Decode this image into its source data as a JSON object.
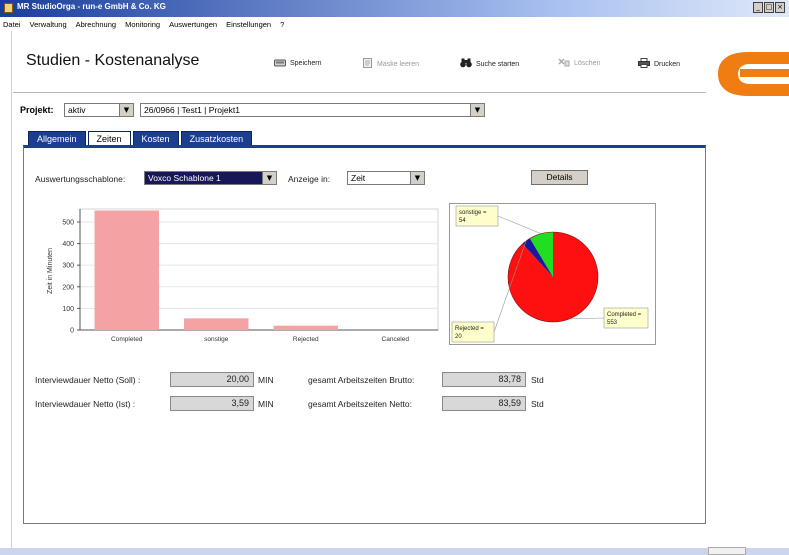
{
  "window": {
    "title": "MR StudioOrga - run-e GmbH & Co. KG",
    "buttons": [
      "_",
      "□",
      "×"
    ]
  },
  "menu": [
    "Datei",
    "Verwaltung",
    "Abrechnung",
    "Monitoring",
    "Auswertungen",
    "Einstellungen",
    "?"
  ],
  "page": {
    "title": "Studien - Kostenanalyse"
  },
  "toolbar": {
    "save": "Speichern",
    "clear": "Maske leeren",
    "search": "Suche starten",
    "delete": "Löschen",
    "print": "Drucken"
  },
  "project": {
    "label": "Projekt:",
    "status": "aktiv",
    "selection": "26/0966 | Test1 | Projekt1"
  },
  "tabs": [
    "Allgemein",
    "Zeiten",
    "Kosten",
    "Zusatzkosten"
  ],
  "active_tab": "Zeiten",
  "filters": {
    "template_label": "Auswertungsschablone:",
    "template_value": "Voxco Schablone 1",
    "display_label": "Anzeige in:",
    "display_value": "Zeit",
    "details_button": "Details"
  },
  "chart_data": [
    {
      "type": "bar",
      "categories": [
        "Completed",
        "sonstige",
        "Rejected",
        "Canceled"
      ],
      "values": [
        553,
        54,
        20,
        0
      ],
      "ylabel": "Zeit in Minuten",
      "ylim": [
        0,
        500
      ],
      "yticks": [
        0,
        100,
        200,
        300,
        400,
        500
      ],
      "grid": true,
      "colors": {
        "bar": "#f4a2a4"
      }
    },
    {
      "type": "pie",
      "labels": [
        "Completed = 553",
        "sonstige = 54",
        "Rejected = 20"
      ],
      "values": [
        553,
        54,
        20
      ],
      "colors": [
        "#ff1010",
        "#22dd22",
        "#1a1aa0"
      ]
    }
  ],
  "metrics": {
    "netto_soll_label": "Interviewdauer Netto (Soll) :",
    "netto_soll_value": "20,00",
    "netto_soll_unit": "MIN",
    "netto_ist_label": "Interviewdauer Netto (Ist) :",
    "netto_ist_value": "3,59",
    "netto_ist_unit": "MIN",
    "brutto_label": "gesamt Arbeitszeiten Brutto:",
    "brutto_value": "83,78",
    "brutto_unit": "Std",
    "netto_label": "gesamt Arbeitszeiten Netto:",
    "netto_value": "83,59",
    "netto_unit": "Std"
  },
  "colors": {
    "accent": "#1b3f8e",
    "logo": "#ef7d11"
  }
}
